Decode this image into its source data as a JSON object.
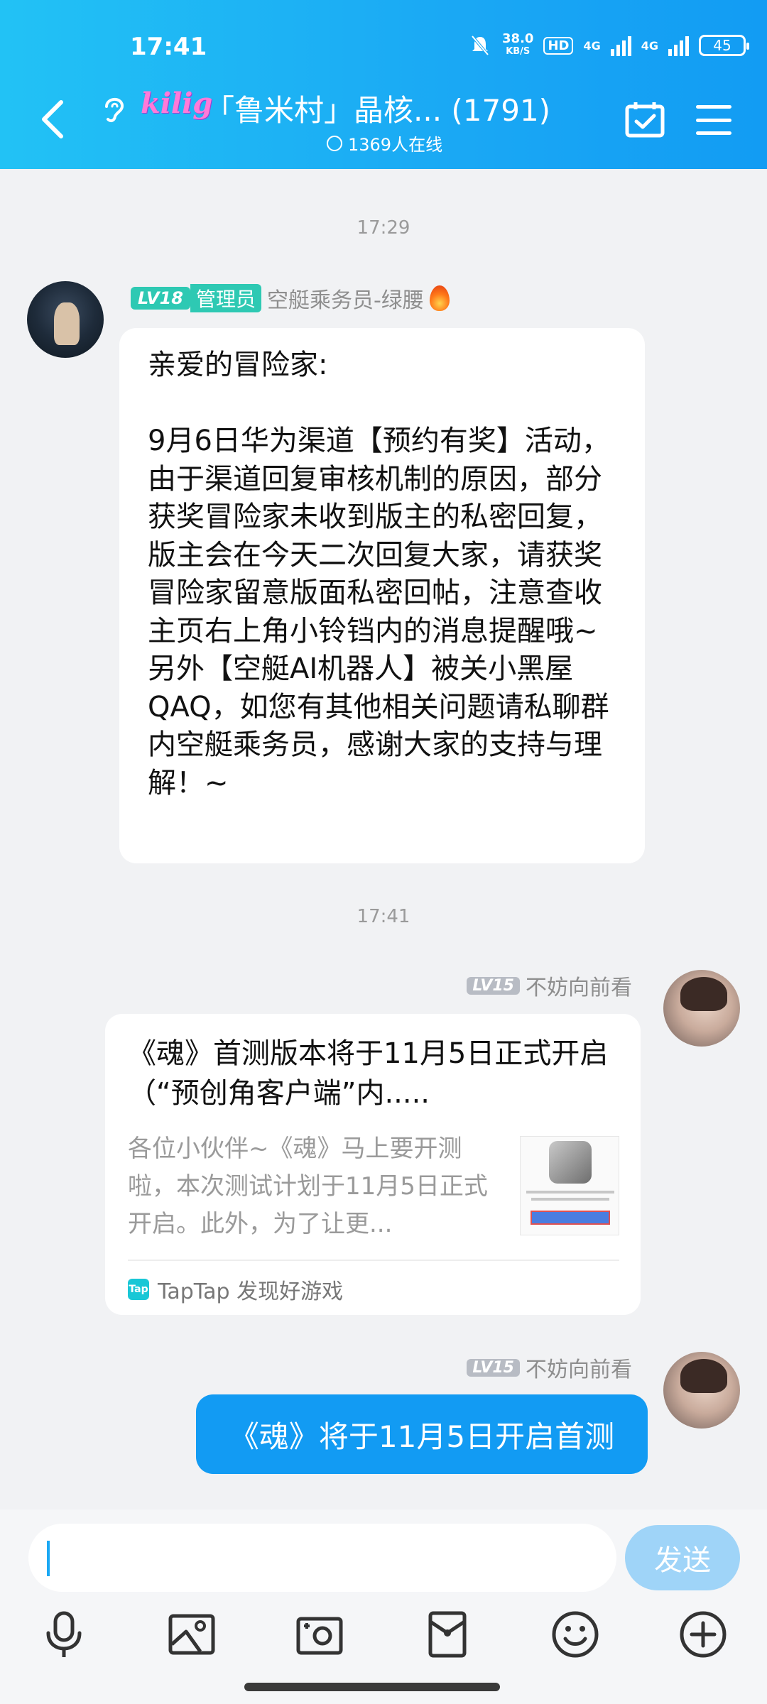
{
  "status_bar": {
    "time": "17:41",
    "net_speed_value": "38.0",
    "net_speed_unit": "KB/S",
    "hd_label": "HD",
    "sim1": "4G",
    "sim2": "4G",
    "battery": "45"
  },
  "header": {
    "logo_text": "kilig",
    "title": "「鲁米村」晶核... (1791)",
    "online": "1369人在线"
  },
  "messages": [
    {
      "time": "17:29"
    },
    {
      "sender_level": "LV18",
      "sender_role": "管理员",
      "sender_name": "空艇乘务员-绿腰",
      "text": "亲爱的冒险家:\n\n9月6日华为渠道【预约有奖】活动，由于渠道回复审核机制的原因，部分获奖冒险家未收到版主的私密回复，版主会在今天二次回复大家，请获奖冒险家留意版面私密回帖，注意查收主页右上角小铃铛内的消息提醒哦~\n另外【空艇AI机器人】被关小黑屋QAQ，如您有其他相关问题请私聊群内空艇乘务员，感谢大家的支持与理解！~"
    },
    {
      "time": "17:41"
    },
    {
      "sender_level": "LV15",
      "sender_name": "不妨向前看",
      "card_title": "《魂》首测版本将于11月5日正式开启（“预创角客户端”内.....",
      "card_desc": "各位小伙伴~《魂》马上要开测啦，本次测试计划于11月5日正式开启。此外，为了让更...",
      "card_source_logo": "Tap",
      "card_source": "TapTap 发现好游戏"
    },
    {
      "sender_level": "LV15",
      "sender_name": "不妨向前看",
      "text": "《魂》将于11月5日开启首测"
    }
  ],
  "input": {
    "send_label": "发送"
  },
  "toolbar": {
    "icons": [
      "microphone-icon",
      "image-icon",
      "camera-icon",
      "red-packet-icon",
      "emoji-icon",
      "plus-icon"
    ]
  },
  "colors": {
    "header_gradient": [
      "#22c2f5",
      "#129cf3"
    ],
    "admin_badge": "#2ec9b3",
    "outgoing_bubble": "#129bf3",
    "send_button": "#9fd4f8"
  }
}
